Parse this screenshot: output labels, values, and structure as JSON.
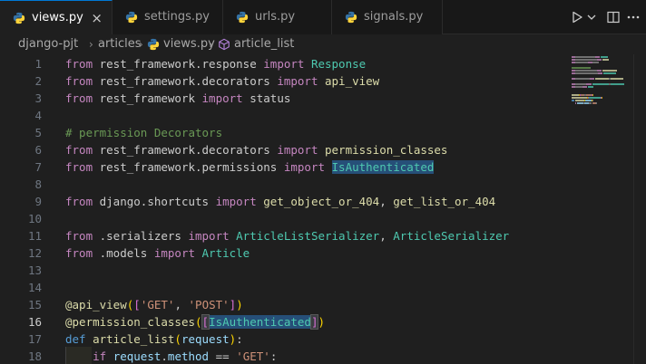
{
  "tabs": [
    {
      "label": "views.py",
      "close": "×"
    },
    {
      "label": "settings.py"
    },
    {
      "label": "urls.py"
    },
    {
      "label": "signals.py"
    }
  ],
  "breadcrumb": {
    "folder1": "django-pjt",
    "folder2": "articles",
    "file": "views.py",
    "symbol": "article_list",
    "sep": "›"
  },
  "editor": {
    "current_line": 16,
    "line_numbers": [
      "1",
      "2",
      "3",
      "4",
      "5",
      "6",
      "7",
      "8",
      "9",
      "10",
      "11",
      "12",
      "13",
      "14",
      "15",
      "16",
      "17",
      "18"
    ],
    "lines": [
      [
        {
          "t": "from",
          "c": "ctl"
        },
        {
          "t": " rest_framework.response ",
          "c": "plain"
        },
        {
          "t": "import",
          "c": "ctl"
        },
        {
          "t": " ",
          "c": "plain"
        },
        {
          "t": "Response",
          "c": "cls"
        }
      ],
      [
        {
          "t": "from",
          "c": "ctl"
        },
        {
          "t": " rest_framework.decorators ",
          "c": "plain"
        },
        {
          "t": "import",
          "c": "ctl"
        },
        {
          "t": " ",
          "c": "plain"
        },
        {
          "t": "api_view",
          "c": "fn"
        }
      ],
      [
        {
          "t": "from",
          "c": "ctl"
        },
        {
          "t": " rest_framework ",
          "c": "plain"
        },
        {
          "t": "import",
          "c": "ctl"
        },
        {
          "t": " status",
          "c": "plain"
        }
      ],
      [],
      [
        {
          "t": "# permission Decorators",
          "c": "cm"
        }
      ],
      [
        {
          "t": "from",
          "c": "ctl"
        },
        {
          "t": " rest_framework.decorators ",
          "c": "plain"
        },
        {
          "t": "import",
          "c": "ctl"
        },
        {
          "t": " ",
          "c": "plain"
        },
        {
          "t": "permission_classes",
          "c": "fn"
        }
      ],
      [
        {
          "t": "from",
          "c": "ctl"
        },
        {
          "t": " rest_framework.permissions ",
          "c": "plain"
        },
        {
          "t": "import",
          "c": "ctl"
        },
        {
          "t": " ",
          "c": "plain"
        },
        {
          "t": "IsAuthenticated",
          "c": "cls hl"
        }
      ],
      [],
      [
        {
          "t": "from",
          "c": "ctl"
        },
        {
          "t": " django.shortcuts ",
          "c": "plain"
        },
        {
          "t": "import",
          "c": "ctl"
        },
        {
          "t": " ",
          "c": "plain"
        },
        {
          "t": "get_object_or_404",
          "c": "fn"
        },
        {
          "t": ", ",
          "c": "plain"
        },
        {
          "t": "get_list_or_404",
          "c": "fn"
        }
      ],
      [],
      [
        {
          "t": "from",
          "c": "ctl"
        },
        {
          "t": " .serializers ",
          "c": "plain"
        },
        {
          "t": "import",
          "c": "ctl"
        },
        {
          "t": " ",
          "c": "plain"
        },
        {
          "t": "ArticleListSerializer",
          "c": "cls"
        },
        {
          "t": ", ",
          "c": "plain"
        },
        {
          "t": "ArticleSerializer",
          "c": "cls"
        }
      ],
      [
        {
          "t": "from",
          "c": "ctl"
        },
        {
          "t": " .models ",
          "c": "plain"
        },
        {
          "t": "import",
          "c": "ctl"
        },
        {
          "t": " ",
          "c": "plain"
        },
        {
          "t": "Article",
          "c": "cls"
        }
      ],
      [],
      [],
      [
        {
          "t": "@",
          "c": "fn"
        },
        {
          "t": "api_view",
          "c": "fn"
        },
        {
          "t": "(",
          "c": "br1"
        },
        {
          "t": "[",
          "c": "br2"
        },
        {
          "t": "'GET'",
          "c": "str"
        },
        {
          "t": ", ",
          "c": "plain"
        },
        {
          "t": "'POST'",
          "c": "str"
        },
        {
          "t": "]",
          "c": "br2"
        },
        {
          "t": ")",
          "c": "br1"
        }
      ],
      [
        {
          "t": "@",
          "c": "fn"
        },
        {
          "t": "permission_classes",
          "c": "fn"
        },
        {
          "t": "(",
          "c": "br1"
        },
        {
          "t": "[",
          "c": "br2 hlb"
        },
        {
          "t": "IsAuthenticated",
          "c": "cls hl"
        },
        {
          "t": "]",
          "c": "br2 hlb"
        },
        {
          "t": ")",
          "c": "br1"
        }
      ],
      [
        {
          "t": "def",
          "c": "kw"
        },
        {
          "t": " ",
          "c": "plain"
        },
        {
          "t": "article_list",
          "c": "fn"
        },
        {
          "t": "(",
          "c": "br1"
        },
        {
          "t": "request",
          "c": "var"
        },
        {
          "t": ")",
          "c": "br1"
        },
        {
          "t": ":",
          "c": "plain"
        }
      ],
      [
        {
          "t": "    ",
          "c": "plain"
        },
        {
          "t": "if",
          "c": "ctl"
        },
        {
          "t": " ",
          "c": "plain"
        },
        {
          "t": "request",
          "c": "var"
        },
        {
          "t": ".",
          "c": "plain"
        },
        {
          "t": "method",
          "c": "var"
        },
        {
          "t": " == ",
          "c": "plain"
        },
        {
          "t": "'GET'",
          "c": "str"
        },
        {
          "t": ":",
          "c": "plain"
        }
      ]
    ]
  },
  "colors": {
    "accent": "#0078d4",
    "python_blue": "#3572a5",
    "python_yellow": "#ffd43b"
  }
}
